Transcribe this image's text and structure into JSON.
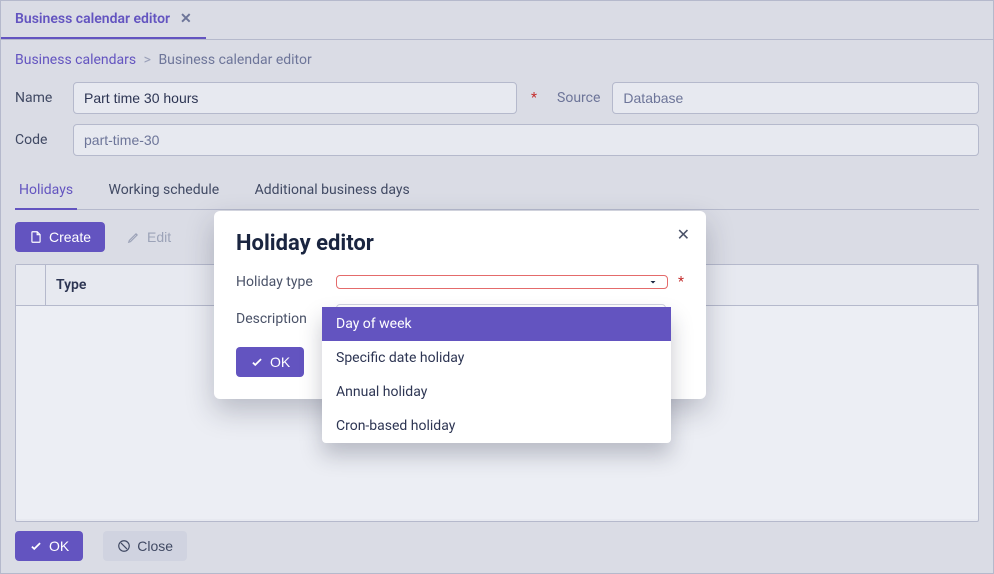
{
  "tab": {
    "title": "Business calendar editor"
  },
  "breadcrumb": {
    "root": "Business calendars",
    "current": "Business calendar editor"
  },
  "form": {
    "name_label": "Name",
    "name_value": "Part time 30 hours",
    "code_label": "Code",
    "code_value": "part-time-30",
    "source_label": "Source",
    "source_value": "Database"
  },
  "tabs": {
    "holidays": "Holidays",
    "schedule": "Working schedule",
    "additional": "Additional business days"
  },
  "toolbar": {
    "create": "Create",
    "edit": "Edit"
  },
  "grid": {
    "col_type": "Type"
  },
  "actions": {
    "ok": "OK",
    "close": "Close"
  },
  "modal": {
    "title": "Holiday editor",
    "type_label": "Holiday type",
    "type_value": "",
    "desc_label": "Description",
    "desc_value": "",
    "ok": "OK",
    "options": {
      "day_of_week": "Day of week",
      "specific": "Specific date holiday",
      "annual": "Annual holiday",
      "cron": "Cron-based holiday"
    }
  }
}
